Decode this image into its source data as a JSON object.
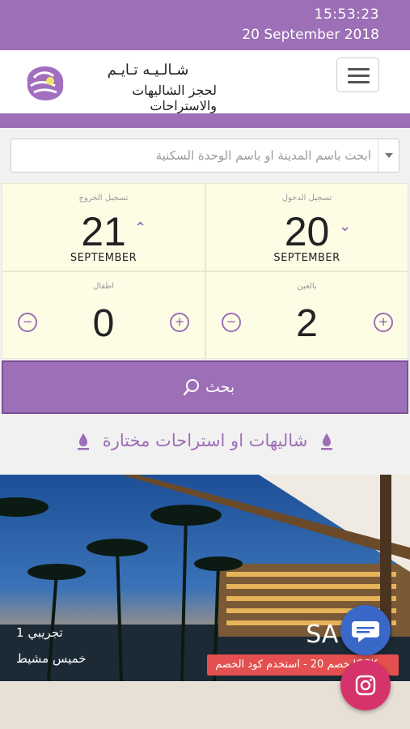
{
  "statusbar": {
    "time": "15:53:23",
    "date": "20 September 2018"
  },
  "logo": {
    "line1": "شـالـيـه تـايـم",
    "line2": "لحجز الشاليهات والاستراحات"
  },
  "search": {
    "placeholder": "ابحث باسم المدينة او باسم الوحدة السكنية"
  },
  "checkout": {
    "label": "تسجيل الخروج",
    "day": "21",
    "month": "SEPTEMBER"
  },
  "checkin": {
    "label": "تسجيل الدخول",
    "day": "20",
    "month": "SEPTEMBER"
  },
  "children": {
    "label": "اطفال",
    "count": "0"
  },
  "adults": {
    "label": "بالغين",
    "count": "2"
  },
  "search_button": {
    "label": "بحث"
  },
  "featured": {
    "title": "شاليهات او استراحات مختارة"
  },
  "listing": {
    "name": "تجريبي 1",
    "city": "خميس مشيط",
    "price": "SA 0",
    "promo": "خصم 20 - استخدم كود الخصم IOPK"
  },
  "icons": {
    "menu": "menu-icon",
    "search": "search-icon",
    "pin": "pin-icon",
    "chat": "chat-icon",
    "instagram": "instagram-icon"
  },
  "colors": {
    "brand": "#9c6fb6",
    "chat": "#3a68c9",
    "instagram": "#d6336c",
    "promo": "#e3504f",
    "date_bg": "#fdfde6"
  }
}
